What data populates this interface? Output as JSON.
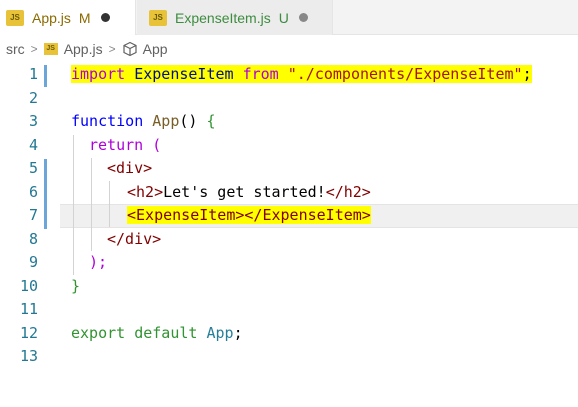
{
  "tabs": [
    {
      "label": "App.js",
      "status": "M",
      "icon": "JS"
    },
    {
      "label": "ExpenseItem.js",
      "status": "U",
      "icon": "JS"
    }
  ],
  "breadcrumb": {
    "folder": "src",
    "file": "App.js",
    "symbol": "App"
  },
  "editor": {
    "lines": [
      {
        "n": "1"
      },
      {
        "n": "2"
      },
      {
        "n": "3"
      },
      {
        "n": "4"
      },
      {
        "n": "5"
      },
      {
        "n": "6"
      },
      {
        "n": "7"
      },
      {
        "n": "8"
      },
      {
        "n": "9"
      },
      {
        "n": "10"
      },
      {
        "n": "11"
      },
      {
        "n": "12"
      },
      {
        "n": "13"
      }
    ],
    "code": {
      "l1_import": "import",
      "l1_id": "ExpenseItem",
      "l1_from": "from",
      "l1_str": "\"./components/ExpenseItem\"",
      "l1_semi": ";",
      "l3_function": "function",
      "l3_name": "App",
      "l3_parens": "()",
      "l3_brace": "{",
      "l4_return": "return",
      "l4_paren": "(",
      "l5_open": "<div>",
      "l6_h2_open": "<h2>",
      "l6_text": "Let's get started!",
      "l6_h2_close": "</h2>",
      "l7_text": "<ExpenseItem></ExpenseItem>",
      "l8_close": "</div>",
      "l9_close": ");",
      "l10_brace": "}",
      "l12_export": "export default",
      "l12_app": "App",
      "l12_semi": ";"
    }
  }
}
